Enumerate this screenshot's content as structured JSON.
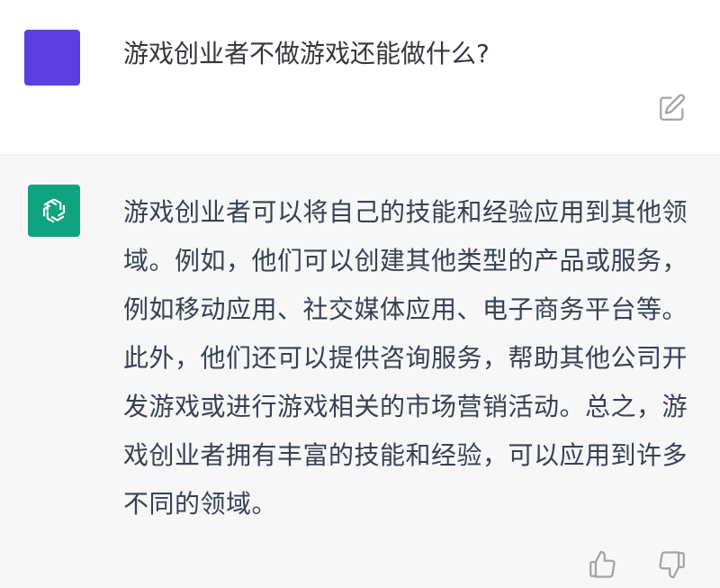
{
  "conversation": {
    "user": {
      "question": "游戏创业者不做游戏还能做什么?",
      "avatar_color": "#5b3fe0",
      "edit_icon": "edit-icon"
    },
    "assistant": {
      "answer": "游戏创业者可以将自己的技能和经验应用到其他领域。例如，他们可以创建其他类型的产品或服务，例如移动应用、社交媒体应用、电子商务平台等。此外，他们还可以提供咨询服务，帮助其他公司开发游戏或进行游戏相关的市场营销活动。总之，游戏创业者拥有丰富的技能和经验，可以应用到许多不同的领域。",
      "avatar_color": "#10a37f",
      "avatar_icon": "openai-logo-icon",
      "feedback_icons": [
        "thumbs-up-icon",
        "thumbs-down-icon"
      ]
    }
  }
}
